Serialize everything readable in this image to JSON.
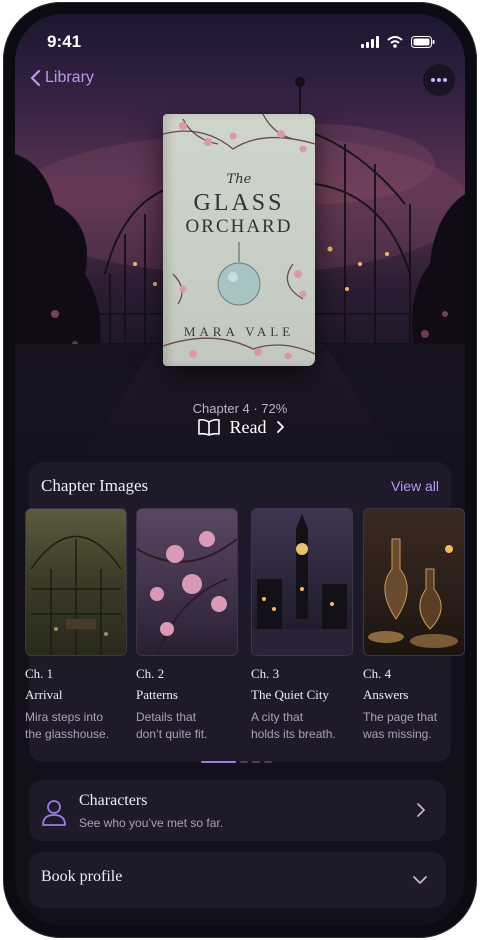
{
  "status": {
    "time": "9:41"
  },
  "nav": {
    "back_label": "Library"
  },
  "book": {
    "cover_the": "The",
    "cover_title_line1": "GLASS",
    "cover_title_line2": "ORCHARD",
    "cover_author": "MARA VALE",
    "progress": "Chapter 4 · 72%",
    "read_label": "Read"
  },
  "chapters_section": {
    "title": "Chapter Images",
    "view_all": "View all",
    "items": [
      {
        "num": "Ch. 1",
        "title": "Arrival",
        "desc_line1": "Mira steps into",
        "desc_line2": "the glasshouse."
      },
      {
        "num": "Ch. 2",
        "title": "Patterns",
        "desc_line1": "Details that",
        "desc_line2": "don’t quite fit."
      },
      {
        "num": "Ch. 3",
        "title": "The Quiet City",
        "desc_line1": "A city that",
        "desc_line2": "holds its breath."
      },
      {
        "num": "Ch. 4",
        "title": "Answers",
        "desc_line1": "The page that",
        "desc_line2": "was missing."
      }
    ],
    "page_indicator": {
      "pages": 4,
      "active": 1
    }
  },
  "characters": {
    "title": "Characters",
    "subtitle": "See who you’ve met so far.",
    "icon": "person-icon"
  },
  "book_profile": {
    "title": "Book profile",
    "icon": "chevron-down-icon"
  },
  "colors": {
    "accent": "#b79bf0",
    "background": "#15111f",
    "card": "#1e1a29"
  }
}
